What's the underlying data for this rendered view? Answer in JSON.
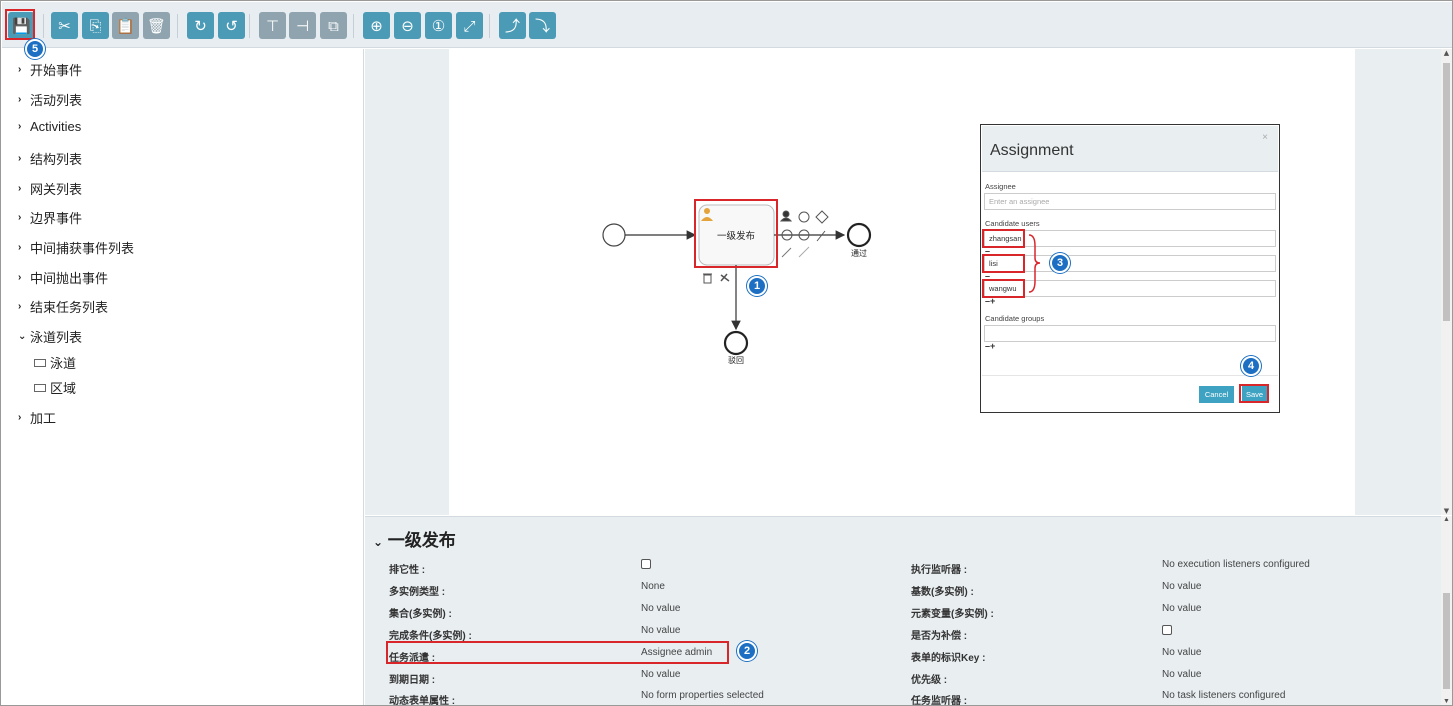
{
  "toolbar": {
    "buttons": [
      {
        "name": "save-button",
        "icon": "save-icon",
        "glyph": "💾"
      },
      {
        "name": "cut-button",
        "icon": "cut-icon",
        "glyph": "✂"
      },
      {
        "name": "copy-button",
        "icon": "copy-icon",
        "glyph": "⎘"
      },
      {
        "name": "paste-button",
        "icon": "paste-icon",
        "glyph": "📋"
      },
      {
        "name": "delete-button",
        "icon": "trash-icon",
        "glyph": "🗑"
      },
      {
        "name": "redo-button",
        "icon": "redo-icon",
        "glyph": "↻"
      },
      {
        "name": "undo-button",
        "icon": "undo-icon",
        "glyph": "↺"
      },
      {
        "name": "align-vertical-button",
        "icon": "align-vertical-icon",
        "glyph": "⊤"
      },
      {
        "name": "align-horizontal-button",
        "icon": "align-horizontal-icon",
        "glyph": "⊣"
      },
      {
        "name": "same-size-button",
        "icon": "same-size-icon",
        "glyph": "⧉"
      },
      {
        "name": "zoom-in-button",
        "icon": "zoom-in-icon",
        "glyph": "⊕"
      },
      {
        "name": "zoom-out-button",
        "icon": "zoom-out-icon",
        "glyph": "⊖"
      },
      {
        "name": "zoom-actual-button",
        "icon": "zoom-actual-icon",
        "glyph": "①"
      },
      {
        "name": "zoom-fit-button",
        "icon": "zoom-fit-icon",
        "glyph": "⤢"
      },
      {
        "name": "add-bendpoint-button",
        "icon": "add-bendpoint-icon",
        "glyph": "⤴"
      },
      {
        "name": "remove-bendpoint-button",
        "icon": "remove-bendpoint-icon",
        "glyph": "⤵"
      }
    ]
  },
  "badges": {
    "b1": "1",
    "b2": "2",
    "b3": "3",
    "b4": "4",
    "b5": "5"
  },
  "sidebar": {
    "items": [
      {
        "label": "开始事件",
        "expanded": false
      },
      {
        "label": "活动列表",
        "expanded": false
      },
      {
        "label": "Activities",
        "expanded": false
      },
      {
        "label": "结构列表",
        "expanded": false
      },
      {
        "label": "网关列表",
        "expanded": false
      },
      {
        "label": "边界事件",
        "expanded": false
      },
      {
        "label": "中间捕获事件列表",
        "expanded": false
      },
      {
        "label": "中间抛出事件",
        "expanded": false
      },
      {
        "label": "结束任务列表",
        "expanded": false
      },
      {
        "label": "泳道列表",
        "expanded": true
      },
      {
        "label": "加工",
        "expanded": false
      }
    ],
    "subitems": [
      "泳道",
      "区域"
    ]
  },
  "diagram": {
    "task_label": "一级发布",
    "end_pass_label": "通过",
    "end_reject_label": "驳回"
  },
  "dialog": {
    "title": "Assignment",
    "close": "×",
    "assignee_label": "Assignee",
    "assignee_placeholder": "Enter an assignee",
    "candidate_users_label": "Candidate users",
    "candidate_users": [
      "zhangsan",
      "lisi",
      "wangwu"
    ],
    "candidate_groups_label": "Candidate groups",
    "cancel_label": "Cancel",
    "save_label": "Save"
  },
  "properties": {
    "title": "一级发布",
    "left": [
      {
        "label": "排它性 :",
        "value": "",
        "checkbox": true
      },
      {
        "label": "多实例类型 :",
        "value": "None"
      },
      {
        "label": "集合(多实例) :",
        "value": "No value"
      },
      {
        "label": "完成条件(多实例) :",
        "value": "No value"
      },
      {
        "label": "任务派遣 :",
        "value": "Assignee admin"
      },
      {
        "label": "到期日期 :",
        "value": "No value"
      },
      {
        "label": "动态表单属性 :",
        "value": "No form properties selected"
      }
    ],
    "right": [
      {
        "label": "执行监听器 :",
        "value": "No execution listeners configured"
      },
      {
        "label": "基数(多实例) :",
        "value": "No value"
      },
      {
        "label": "元素变量(多实例) :",
        "value": "No value"
      },
      {
        "label": "是否为补偿 :",
        "value": "",
        "checkbox": true
      },
      {
        "label": "表单的标识Key :",
        "value": "No value"
      },
      {
        "label": "优先级 :",
        "value": "No value"
      },
      {
        "label": "任务监听器 :",
        "value": "No task listeners configured"
      }
    ]
  },
  "colors": {
    "accent": "#4c9bb6",
    "highlight": "#d9262b",
    "badge": "#1c6fc2"
  }
}
